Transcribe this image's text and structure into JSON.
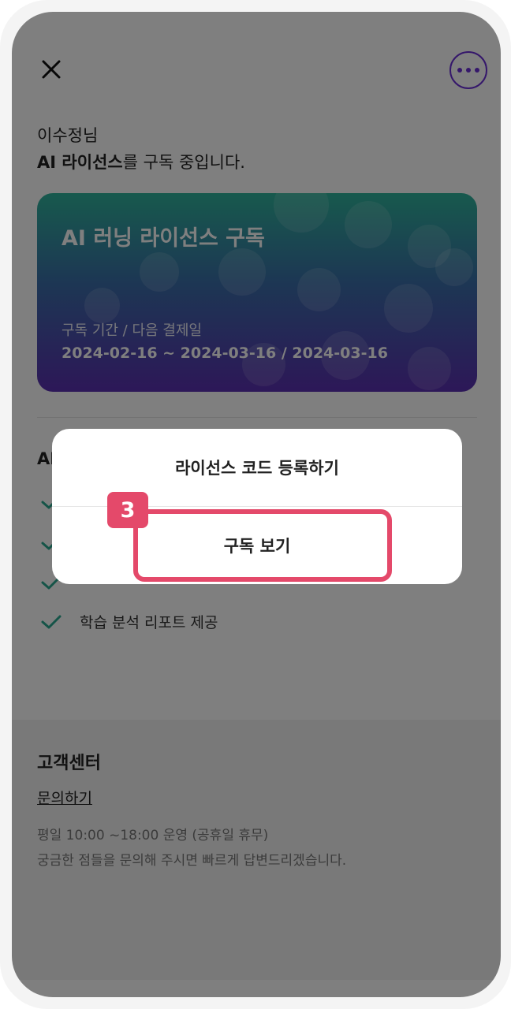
{
  "header": {
    "close_icon": "close-icon",
    "more_icon": "more-horizontal-icon",
    "accent_color": "#6a2fd6"
  },
  "greeting": {
    "line1": "이수정님",
    "license_name": "AI 라이선스",
    "line2_suffix": "를 구독 중입니다."
  },
  "card": {
    "title": "AI 러닝 라이선스 구독",
    "period_label": "구독 기간 / 다음 결제일",
    "period_value": "2024-02-16 ~ 2024-03-16 / 2024-03-16"
  },
  "features": {
    "title_visible": "AI",
    "items": [
      "",
      "",
      "",
      "학습 분석 리포트 제공"
    ],
    "check_color": "#2aa890"
  },
  "support": {
    "title": "고객센터",
    "link": "문의하기",
    "hours": "평일 10:00 ~18:00 운영 (공휴일 휴무)",
    "note": "궁금한 점들을 문의해 주시면 빠르게 답변드리겠습니다."
  },
  "action_sheet": {
    "register_code": "라이선스 코드 등록하기",
    "view_subscription": "구독 보기"
  },
  "annotation": {
    "step": "3",
    "color": "#e4496a"
  }
}
